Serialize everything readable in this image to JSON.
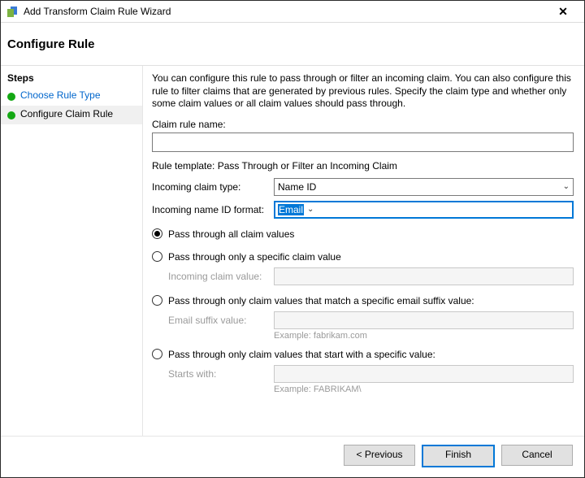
{
  "window": {
    "title": "Add Transform Claim Rule Wizard"
  },
  "header": {
    "title": "Configure Rule"
  },
  "sidebar": {
    "heading": "Steps",
    "items": [
      {
        "label": "Choose Rule Type",
        "link": true
      },
      {
        "label": "Configure Claim Rule",
        "link": false,
        "selected": true
      }
    ]
  },
  "main": {
    "intro": "You can configure this rule to pass through or filter an incoming claim. You can also configure this rule to filter claims that are generated by previous rules. Specify the claim type and whether only some claim values or all claim values should pass through.",
    "claim_rule_name_label": "Claim rule name:",
    "claim_rule_name_value": "",
    "rule_template_label": "Rule template: Pass Through or Filter an Incoming Claim",
    "incoming_claim_type_label": "Incoming claim type:",
    "incoming_claim_type_value": "Name ID",
    "incoming_name_id_format_label": "Incoming name ID format:",
    "incoming_name_id_format_value": "Email",
    "radio": {
      "opt1": "Pass through all claim values",
      "opt2": "Pass through only a specific claim value",
      "opt2_sub_label": "Incoming claim value:",
      "opt3": "Pass through only claim values that match a specific email suffix value:",
      "opt3_sub_label": "Email suffix value:",
      "opt3_hint": "Example: fabrikam.com",
      "opt4": "Pass through only claim values that start with a specific value:",
      "opt4_sub_label": "Starts with:",
      "opt4_hint": "Example: FABRIKAM\\"
    },
    "selected_radio": 1
  },
  "footer": {
    "previous": "< Previous",
    "finish": "Finish",
    "cancel": "Cancel"
  }
}
